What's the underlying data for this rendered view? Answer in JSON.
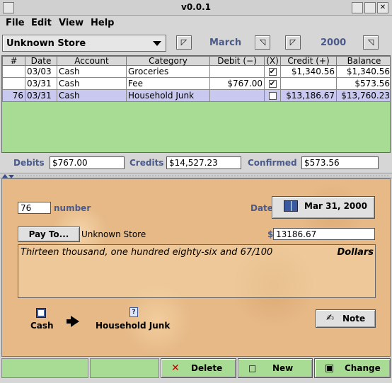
{
  "window": {
    "title": "v0.0.1",
    "close_glyph": "✕"
  },
  "menu": [
    "File",
    "Edit",
    "View",
    "Help"
  ],
  "toolbar": {
    "store": "Unknown Store",
    "month": "March",
    "year": "2000",
    "prev_glyph": "◸",
    "next_glyph": "◹"
  },
  "ledger": {
    "headers": [
      "#",
      "Date",
      "Account",
      "Category",
      "Debit (−)",
      "(X)",
      "Credit (+)",
      "Balance"
    ],
    "rows": [
      {
        "num": "",
        "date": "03/03",
        "account": "Cash",
        "category": "Groceries",
        "debit": "",
        "checked": "✔",
        "credit": "$1,340.56",
        "balance": "$1,340.56"
      },
      {
        "num": "",
        "date": "03/31",
        "account": "Cash",
        "category": "Fee",
        "debit": "$767.00",
        "checked": "✔",
        "credit": "",
        "balance": "$573.56"
      },
      {
        "num": "76",
        "date": "03/31",
        "account": "Cash",
        "category": "Household Junk",
        "debit": "",
        "checked": "",
        "credit": "$13,186.67",
        "balance": "$13,760.23"
      }
    ]
  },
  "totals": {
    "debits_label": "Debits",
    "debits": "$767.00",
    "credits_label": "Credits",
    "credits": "$14,527.23",
    "confirmed_label": "Confirmed",
    "confirmed": "$573.56"
  },
  "check": {
    "number": "76",
    "number_label": "number",
    "date_label": "Date",
    "date": "Mar 31, 2000",
    "payto_label": "Pay To...",
    "payee": "Unknown Store",
    "currency": "$",
    "amount": "13186.67",
    "amount_words": "Thirteen thousand, one hundred eighty-six and 67/100",
    "dollars_label": "Dollars",
    "from_account": "Cash",
    "to_account": "Household Junk",
    "note_label": "Note"
  },
  "actions": {
    "delete_label": "Delete",
    "new_label": "New",
    "change_label": "Change"
  },
  "colors": {
    "ledger_bg": "#a8dc94",
    "accent_text": "#4a5a8a",
    "selected_row": "#c8c8f0",
    "delete_icon": "#cc0000"
  }
}
